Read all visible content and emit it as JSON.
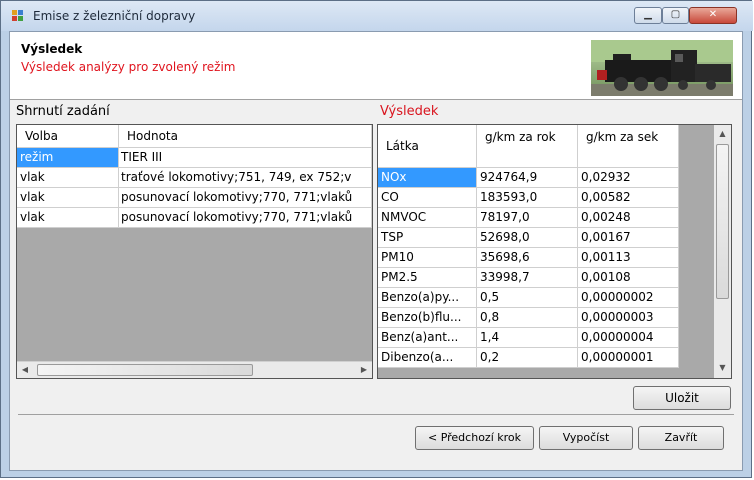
{
  "window": {
    "title": "Emise z železniční dopravy",
    "controls": {
      "minimize": "▁",
      "maximize": "▢",
      "close": "✕"
    }
  },
  "header": {
    "title": "Výsledek",
    "subtitle": "Výsledek analýzy pro zvolený režim"
  },
  "left_panel": {
    "label": "Shrnutí zadání",
    "columns": [
      "Volba",
      "Hodnota"
    ],
    "rows": [
      [
        "režim",
        "TIER III"
      ],
      [
        "vlak",
        "traťové lokomotivy;751, 749, ex 752;v"
      ],
      [
        "vlak",
        "posunovací lokomotivy;770, 771;vlaků"
      ],
      [
        "vlak",
        "posunovací lokomotivy;770, 771;vlaků"
      ]
    ],
    "selected_row": 0
  },
  "right_panel": {
    "label": "Výsledek",
    "label_color": "#d9141e",
    "columns": [
      "Látka",
      "g/km za rok",
      "g/km za sek"
    ],
    "rows": [
      [
        "NOx",
        "924764,9",
        "0,02932"
      ],
      [
        "CO",
        "183593,0",
        "0,00582"
      ],
      [
        "NMVOC",
        "78197,0",
        "0,00248"
      ],
      [
        "TSP",
        "52698,0",
        "0,00167"
      ],
      [
        "PM10",
        "35698,6",
        "0,00113"
      ],
      [
        "PM2.5",
        "33998,7",
        "0,00108"
      ],
      [
        "Benzo(a)py...",
        "0,5",
        "0,00000002"
      ],
      [
        "Benzo(b)flu...",
        "0,8",
        "0,00000003"
      ],
      [
        "Benz(a)ant...",
        "1,4",
        "0,00000004"
      ],
      [
        "Dibenzo(a...",
        "0,2",
        "0,00000001"
      ]
    ],
    "selected_row": 0
  },
  "buttons": {
    "save": "Uložit",
    "previous": "< Předchozí krok",
    "calculate": "Vypočíst",
    "close": "Zavřít"
  },
  "colors": {
    "selection": "#3399ff",
    "subtitle": "#e0141e"
  }
}
